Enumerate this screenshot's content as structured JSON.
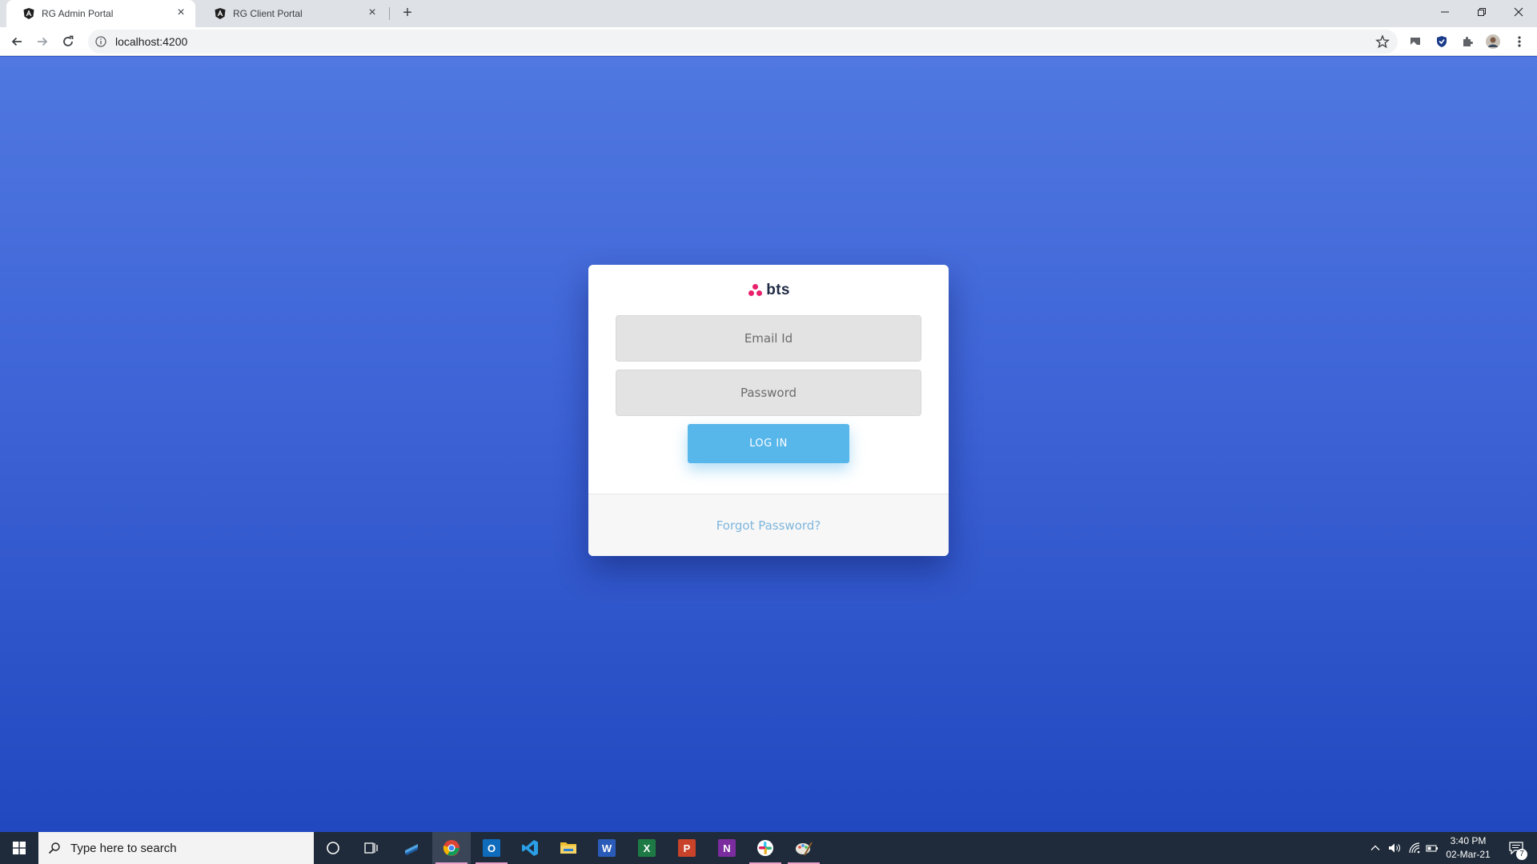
{
  "browser": {
    "tabs": [
      {
        "title": "RG Admin Portal",
        "active": true,
        "close": "×"
      },
      {
        "title": "RG Client Portal",
        "active": false,
        "close": "×"
      }
    ],
    "new_tab": "+",
    "address": "localhost:4200",
    "icons": [
      "back-icon",
      "forward-icon",
      "reload-icon",
      "info-icon",
      "star-icon",
      "minimize-icon",
      "restore-icon",
      "close-window-icon",
      "extensions-icon",
      "menu-icon"
    ]
  },
  "login": {
    "logo_text": "bts",
    "email_placeholder": "Email Id",
    "password_placeholder": "Password",
    "login_label": "LOG IN",
    "forgot_label": "Forgot Password?"
  },
  "taskbar": {
    "search_placeholder": "Type here to search",
    "apps": [
      "cortana-icon",
      "task-view-icon",
      "app-icon",
      "chrome-icon",
      "outlook-icon",
      "vscode-icon",
      "file-explorer-icon",
      "word-icon",
      "excel-icon",
      "powerpoint-icon",
      "onenote-icon",
      "slack-icon",
      "paint-icon"
    ],
    "app_letters": {
      "outlook": "O",
      "word": "W",
      "excel": "X",
      "powerpoint": "P",
      "onenote": "N"
    },
    "time": "3:40 PM",
    "date": "02-Mar-21",
    "notification_count": "7"
  },
  "colors": {
    "background_top": "#5078e0",
    "background_bottom": "#2248c0",
    "login_button": "#57b6ea",
    "logo_dots": "#e9206b",
    "forgot_link": "#7fb6dc"
  }
}
